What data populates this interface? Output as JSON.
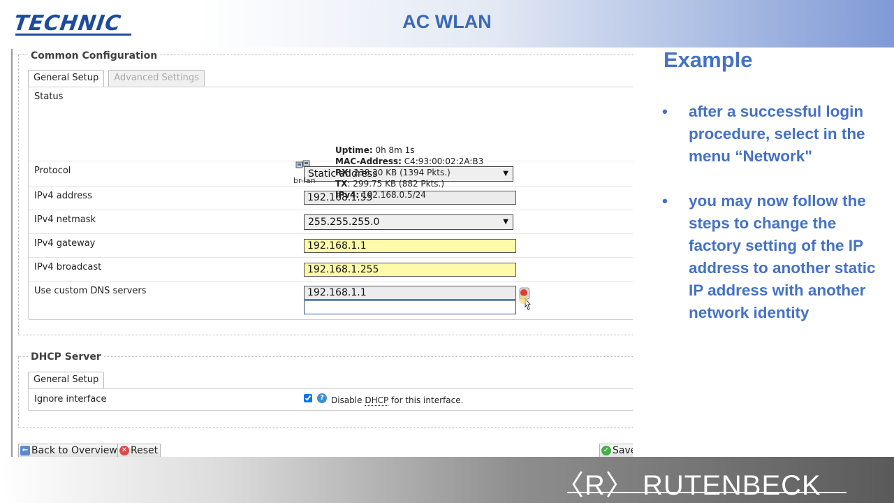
{
  "header": {
    "logo": "TECHNIC",
    "title": "AC WLAN"
  },
  "common_config": {
    "legend": "Common Configuration",
    "tabs": [
      "General Setup",
      "Advanced Settings"
    ],
    "status": {
      "label": "Status",
      "icon_label": "br-lan",
      "uptime_key": "Uptime:",
      "uptime_val": "0h 8m 1s",
      "mac_key": "MAC-Address:",
      "mac_val": "C4:93:00:02:2A:B3",
      "rx_key": "RX",
      "rx_val": ": 238.30 KB (1394 Pkts.)",
      "tx_key": "TX",
      "tx_val": ": 299.75 KB (882 Pkts.)",
      "ipv4_key": "IPv4:",
      "ipv4_val": "192.168.0.5/24"
    },
    "protocol": {
      "label": "Protocol",
      "value": "Static address"
    },
    "ipv4_address": {
      "label": "IPv4 address",
      "value": "192.168.1.55"
    },
    "ipv4_netmask": {
      "label": "IPv4 netmask",
      "value": "255.255.255.0"
    },
    "ipv4_gateway": {
      "label": "IPv4 gateway",
      "value": "192.168.1.1"
    },
    "ipv4_broadcast": {
      "label": "IPv4 broadcast",
      "value": "192.168.1.255"
    },
    "dns": {
      "label": "Use custom DNS servers",
      "value": "192.168.1.1",
      "value2": ""
    }
  },
  "dhcp": {
    "legend": "DHCP Server",
    "tab": "General Setup",
    "ignore_label": "Ignore interface",
    "ignore_checked": true,
    "ignore_desc_prefix": "Disable ",
    "ignore_desc_abbr": "DHCP",
    "ignore_desc_suffix": " for this interface."
  },
  "buttons": {
    "back": "Back to Overview",
    "reset": "Reset",
    "save": "Save"
  },
  "right": {
    "title": "Example",
    "bullet_char": "•",
    "bullet1": "after a successful login procedure, select in the menu “Network\"",
    "bullet2": "you may now follow the steps to change the factory setting of the IP address to another static IP address with another network identity"
  },
  "footer": {
    "brand": "〈R〉 RUTENBECK"
  },
  "colors": {
    "accent_blue": "#4472c4",
    "field_yellow": "#fdfbaa"
  }
}
